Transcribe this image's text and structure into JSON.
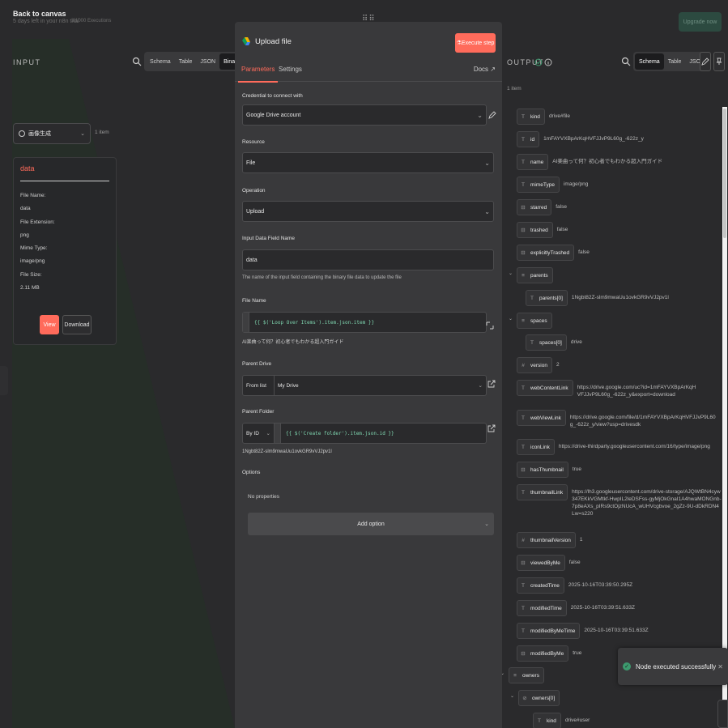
{
  "topbar": {
    "back": "Back to canvas",
    "trial": "5 days left in your n8n trial",
    "executions": "3/1000 Executions",
    "upgrade": "Upgrade now"
  },
  "input": {
    "title": "INPUT",
    "views": [
      "Schema",
      "Table",
      "JSON",
      "Binary"
    ],
    "active_view": "Binary",
    "node": "画像生成",
    "items": "1 item",
    "binary": {
      "name": "data",
      "rows": [
        "File Name:",
        "data",
        "File Extension:",
        "png",
        "Mime Type:",
        "image/png",
        "File Size:",
        "2.11 MB"
      ],
      "view": "View",
      "download": "Download"
    }
  },
  "modal": {
    "title": "Upload file",
    "execute": "Execute step",
    "tabs": [
      "Parameters",
      "Settings"
    ],
    "docs": "Docs",
    "credential_label": "Credential to connect with",
    "credential_value": "Google Drive account",
    "resource_label": "Resource",
    "resource_value": "File",
    "operation_label": "Operation",
    "operation_value": "Upload",
    "input_field_label": "Input Data Field Name",
    "input_field_value": "data",
    "input_field_hint": "The name of the input field containing the binary file data to update the file",
    "file_name_label": "File Name",
    "file_name_expr": "{{ $('Loop Over Items').item.json.item }}",
    "file_name_result": "AI楽曲って何？初心者でもわかる超入門ガイド",
    "parent_drive_label": "Parent Drive",
    "parent_drive_mode": "From list",
    "parent_drive_value": "My Drive",
    "parent_folder_label": "Parent Folder",
    "parent_folder_mode": "By ID",
    "parent_folder_expr": "{{ $('Create folder').item.json.id }}",
    "parent_folder_result": "1Ngbt82Z-slm9mwaUu1ovkGR9vVJ2pv1l",
    "options_label": "Options",
    "no_properties": "No properties",
    "add_option": "Add option"
  },
  "output": {
    "title": "OUTPUT",
    "views": [
      "Schema",
      "Table",
      "JSON"
    ],
    "active_view": "Schema",
    "items": "1 item",
    "fields": [
      {
        "key": "kind",
        "value": "drive#file"
      },
      {
        "key": "id",
        "value": "1mFAYVXBpArKqHVFJJvP9L60g_-622z_y"
      },
      {
        "key": "name",
        "value": "AI楽曲って何？初心者でもわかる超入門ガイド"
      },
      {
        "key": "mimeType",
        "value": "image/png"
      },
      {
        "key": "starred",
        "value": "false"
      },
      {
        "key": "trashed",
        "value": "false"
      },
      {
        "key": "explicitlyTrashed",
        "value": "false"
      },
      {
        "key": "parents",
        "value": ""
      },
      {
        "key": "parents[0]",
        "value": "1Ngbt82Z-slm9mwaUu1ovkGR9vVJ2pv1l"
      },
      {
        "key": "spaces",
        "value": ""
      },
      {
        "key": "spaces[0]",
        "value": "drive"
      },
      {
        "key": "version",
        "value": "2"
      },
      {
        "key": "webContentLink",
        "value": "https://drive.google.com/uc?id=1mFAYVXBpArKqHVFJJvP9L60g_-622z_y&export=download"
      },
      {
        "key": "webViewLink",
        "value": "https://drive.google.com/file/d/1mFAYVXBpArKqHVFJJvP9L60g_-622z_y/view?usp=drivesdk"
      },
      {
        "key": "iconLink",
        "value": "https://drive-thirdparty.googleusercontent.com/16/type/image/png"
      },
      {
        "key": "hasThumbnail",
        "value": "true"
      },
      {
        "key": "thumbnailLink",
        "value": "https://lh3.googleusercontent.com/drive-storage/AJQWtBN4cyw347EKkVGMtkf-HwpIL2leDSFss-gyMjOkGnaI1A4hwaMONGnb-7p8eAXs_pIRs9ctOjzNUcA_wUHVcgbvoe_2gZz-9U-dDkRDN4Lw=s220"
      },
      {
        "key": "thumbnailVersion",
        "value": "1"
      },
      {
        "key": "viewedByMe",
        "value": "false"
      },
      {
        "key": "createdTime",
        "value": "2025-10-16T03:39:50.295Z"
      },
      {
        "key": "modifiedTime",
        "value": "2025-10-16T03:39:51.633Z"
      },
      {
        "key": "modifiedByMeTime",
        "value": "2025-10-16T03:39:51.633Z"
      },
      {
        "key": "modifiedByMe",
        "value": "true"
      },
      {
        "key": "owners",
        "value": ""
      },
      {
        "key": "owners[0]",
        "value": ""
      },
      {
        "key": "kind",
        "value": "drive#user"
      }
    ]
  },
  "toast": {
    "message": "Node executed successfully"
  },
  "colors": {
    "accent": "#ff6b5b",
    "success": "#3c9a6e",
    "panel": "#2a2a2c",
    "modal": "#39393b"
  }
}
